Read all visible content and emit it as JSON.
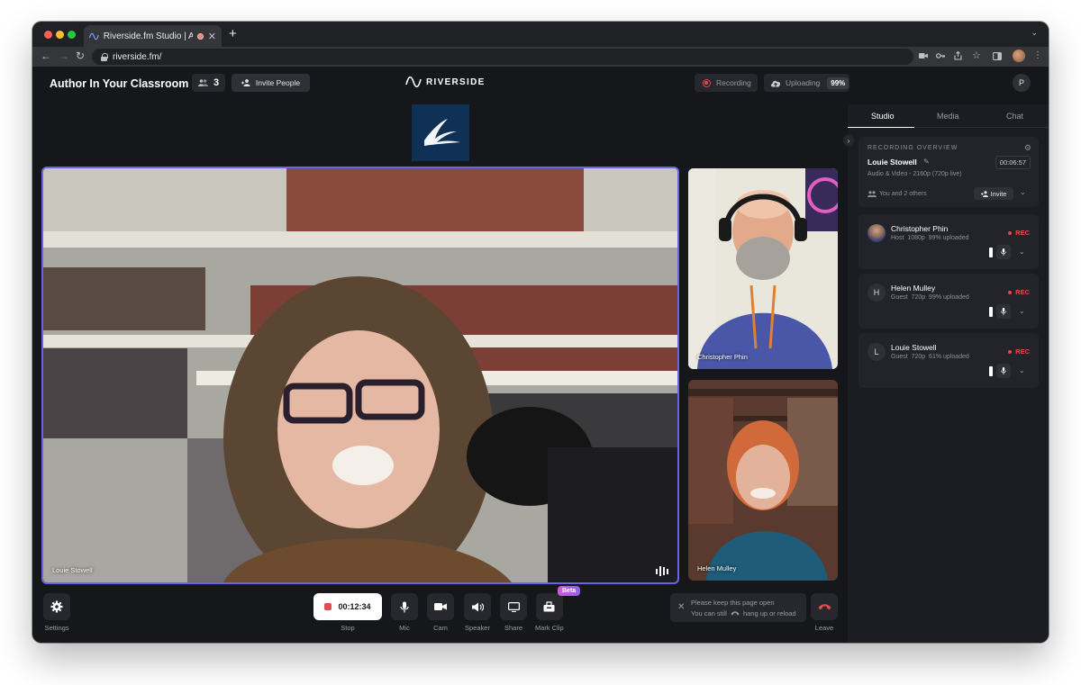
{
  "browser": {
    "tab_title": "Riverside.fm Studio | Author In Your Classroom",
    "tab_close": "✕",
    "new_tab": "+",
    "url": "riverside.fm/"
  },
  "header": {
    "studio_name": "Author In Your Classroom",
    "participant_count": "3",
    "invite_label": "Invite People",
    "brand": "RIVERSIDE",
    "recording_label": "Recording",
    "uploading_label": "Uploading",
    "upload_percent": "99%",
    "user_initial": "P"
  },
  "videos": {
    "main_name": "Louie Stowell",
    "side1_name": "Christopher Phin",
    "side2_name": "Helen Mulley"
  },
  "controls": {
    "settings": "Settings",
    "timer": "00:12:34",
    "stop": "Stop",
    "mic": "Mic",
    "cam": "Cam",
    "speaker": "Speaker",
    "share": "Share",
    "mark_clip": "Mark Clip",
    "beta": "Beta",
    "notice_line1": "Please keep this page open",
    "notice_line2a": "You can still",
    "notice_line2b": "hang up or reload",
    "leave": "Leave"
  },
  "panel": {
    "tabs": [
      "Studio",
      "Media",
      "Chat"
    ],
    "overview": {
      "heading": "RECORDING OVERVIEW",
      "name": "Louie Stowell",
      "time": "00:06:57",
      "meta": "Audio & Video - 2160p (720p live)",
      "others": "You and 2 others",
      "invite": "Invite"
    },
    "participants": [
      {
        "initial": "",
        "name": "Christopher Phin",
        "role": "Host",
        "res": "1080p",
        "uploaded": "99% uploaded",
        "status": "REC"
      },
      {
        "initial": "H",
        "name": "Helen Mulley",
        "role": "Guest",
        "res": "720p",
        "uploaded": "99% uploaded",
        "status": "REC"
      },
      {
        "initial": "L",
        "name": "Louie Stowell",
        "role": "Guest",
        "res": "720p",
        "uploaded": "61% uploaded",
        "status": "REC"
      }
    ]
  },
  "colors": {
    "accent": "#6c63e6",
    "rec_red": "#e5484d",
    "background": "#15171b",
    "panel": "#1b1d22"
  }
}
